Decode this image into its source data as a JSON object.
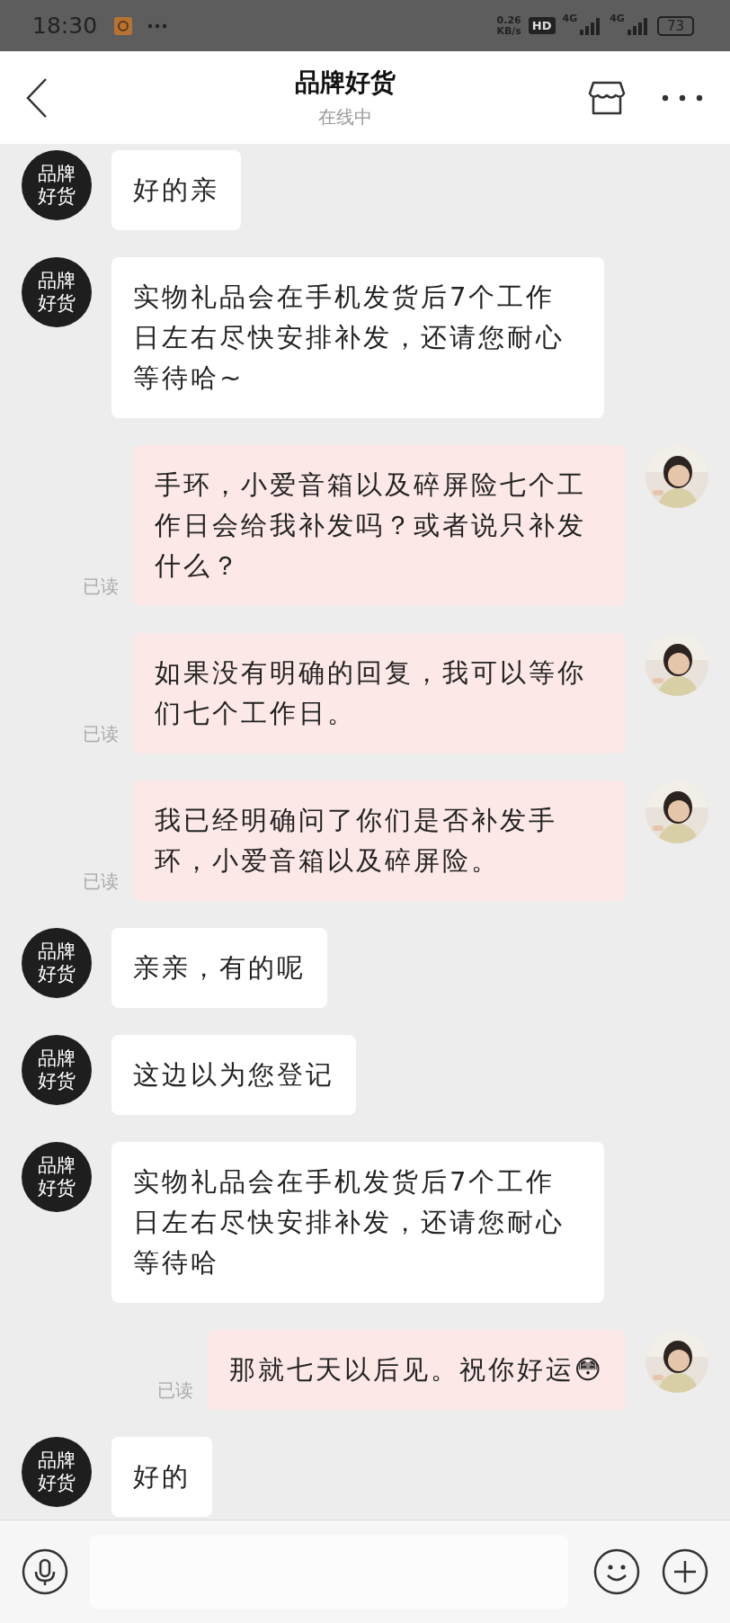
{
  "status_bar": {
    "time": "18:30",
    "speed": "0.26",
    "speed_unit": "KB/s",
    "hd": "HD",
    "networks": [
      "4G",
      "4G"
    ],
    "battery": "73"
  },
  "header": {
    "title": "品牌好货",
    "subtitle": "在线中"
  },
  "messages": [
    {
      "kind": "incoming",
      "avatar_label": "品牌好货",
      "text": "好的亲"
    },
    {
      "kind": "incoming",
      "avatar_label": "品牌好货",
      "text": "实物礼品会在手机发货后7个工作日左右尽快安排补发，还请您耐心等待哈~"
    },
    {
      "kind": "outgoing",
      "status": "已读",
      "text": "手环，小爱音箱以及碎屏险七个工作日会给我补发吗？或者说只补发什么？"
    },
    {
      "kind": "outgoing",
      "status": "已读",
      "text": "如果没有明确的回复，我可以等你们七个工作日。"
    },
    {
      "kind": "outgoing",
      "status": "已读",
      "text": "我已经明确问了你们是否补发手环，小爱音箱以及碎屏险。"
    },
    {
      "kind": "incoming",
      "avatar_label": "品牌好货",
      "text": "亲亲，有的呢"
    },
    {
      "kind": "incoming",
      "avatar_label": "品牌好货",
      "text": "这边以为您登记"
    },
    {
      "kind": "incoming",
      "avatar_label": "品牌好货",
      "text": "实物礼品会在手机发货后7个工作日左右尽快安排补发，还请您耐心等待哈"
    },
    {
      "kind": "outgoing",
      "status": "已读",
      "text": "那就七天以后见。祝你好运😳"
    },
    {
      "kind": "incoming",
      "avatar_label": "品牌好货",
      "text": "好的"
    }
  ]
}
